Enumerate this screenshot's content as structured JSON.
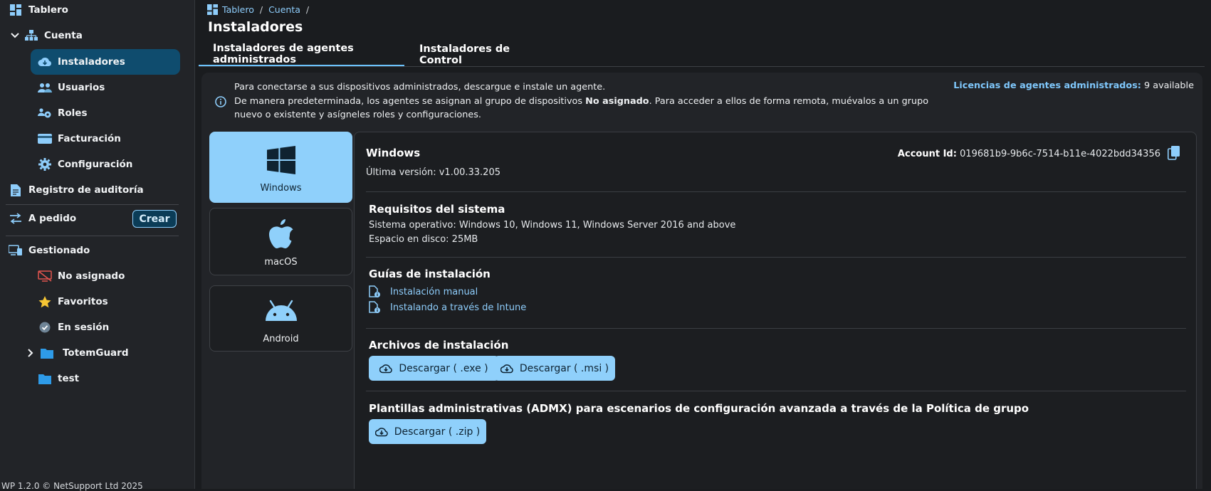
{
  "sidebar": {
    "items": [
      {
        "label": "Tablero"
      },
      {
        "label": "Cuenta"
      },
      {
        "label": "Instaladores"
      },
      {
        "label": "Usuarios"
      },
      {
        "label": "Roles"
      },
      {
        "label": "Facturación"
      },
      {
        "label": "Configuración"
      },
      {
        "label": "Registro de auditoría"
      },
      {
        "label": "A pedido"
      },
      {
        "label": "Gestionado"
      },
      {
        "label": "No asignado"
      },
      {
        "label": "Favoritos"
      },
      {
        "label": "En sesión"
      },
      {
        "label": "TotemGuard"
      },
      {
        "label": "test"
      }
    ],
    "crear_label": "Crear",
    "footer": "WP 1.2.0 © NetSupport Ltd 2025"
  },
  "breadcrumb": {
    "items": [
      "Tablero",
      "Cuenta"
    ],
    "separator": "/"
  },
  "page_title": "Instaladores",
  "tabs": [
    {
      "label": "Instaladores de agentes administrados",
      "active": true
    },
    {
      "label": "Instaladores de Control",
      "active": false
    }
  ],
  "info": {
    "line1": "Para conectarse a sus dispositivos administrados, descargue e instale un agente.",
    "line2_pre": "De manera predeterminada, los agentes se asignan al grupo de dispositivos ",
    "line2_bold": "No asignado",
    "line2_post": ". Para acceder a ellos de forma remota, muévalos a un grupo nuevo o existente y asígneles roles y configuraciones."
  },
  "license": {
    "label": "Licencias de agentes administrados:",
    "value": "9 available"
  },
  "os_options": [
    {
      "label": "Windows",
      "selected": true
    },
    {
      "label": "macOS",
      "selected": false
    },
    {
      "label": "Android",
      "selected": false
    }
  ],
  "details": {
    "title": "Windows",
    "version": "Última versión: v1.00.33.205",
    "account_label": "Account Id:",
    "account_value": "019681b9-9b6c-7514-b11e-4022bdd34356",
    "requirements": {
      "title": "Requisitos del sistema",
      "os": "Sistema operativo: Windows 10, Windows 11, Windows Server 2016 and above",
      "disk": "Espacio en disco: 25MB"
    },
    "guides": {
      "title": "Guías de instalación",
      "items": [
        "Instalación manual",
        "Instalando a través de Intune"
      ]
    },
    "files": {
      "title": "Archivos de instalación",
      "buttons": [
        "Descargar ( .exe )",
        "Descargar ( .msi )"
      ]
    },
    "admx": {
      "title": "Plantillas administrativas (ADMX) para escenarios de configuración avanzada a través de la Política de grupo",
      "button": "Descargar ( .zip )"
    }
  },
  "colors": {
    "accent": "#8fd0fb",
    "active_nav": "#0f4c6e",
    "link": "#8ecdfb",
    "background": "#1a1c1f",
    "panel": "#222428"
  }
}
